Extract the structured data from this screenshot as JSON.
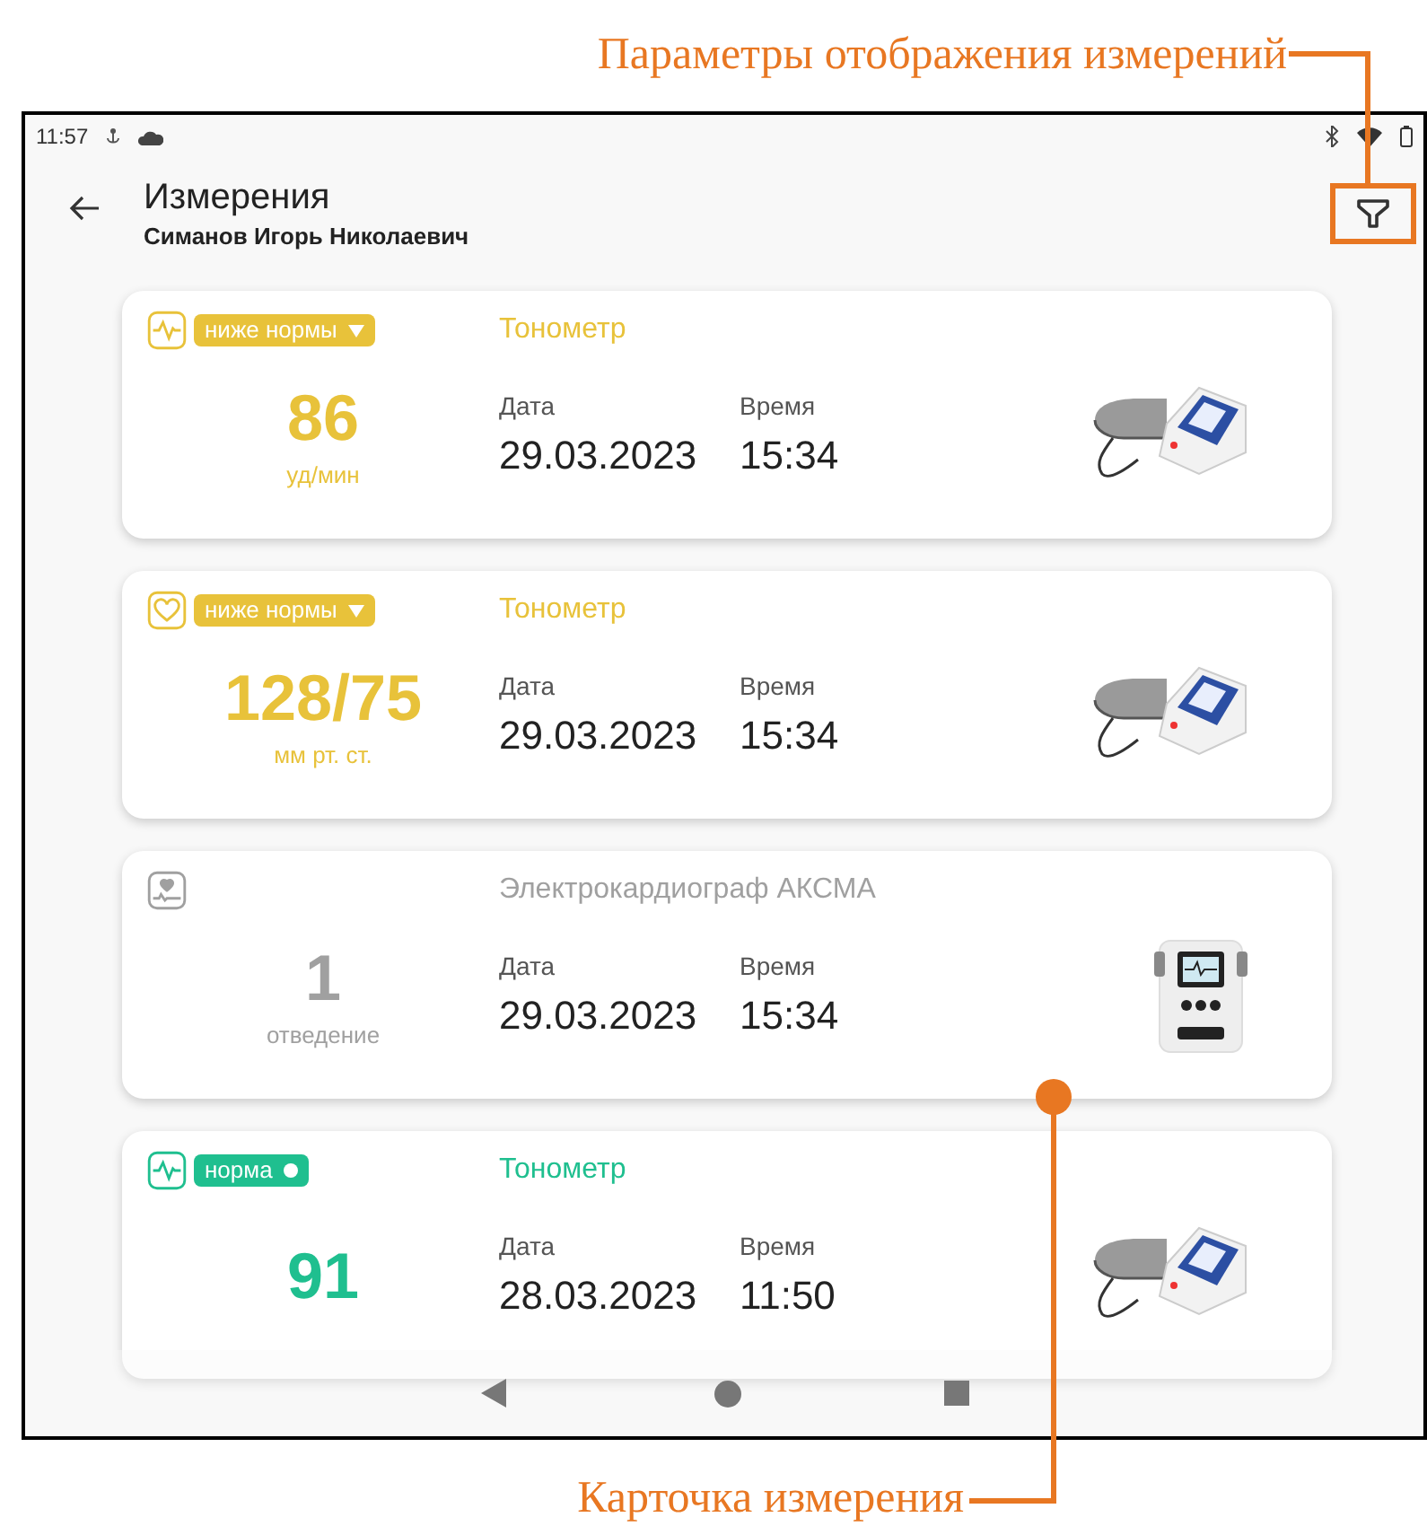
{
  "annotations": {
    "filter": "Параметры отображения измерений",
    "card": "Карточка измерения"
  },
  "status_bar": {
    "time": "11:57"
  },
  "header": {
    "title": "Измерения",
    "subtitle": "Симанов Игорь Николаевич"
  },
  "cards": [
    {
      "kind": "pulse",
      "color": "#e8c23a",
      "badge": {
        "kind": "below",
        "label": "ниже нормы"
      },
      "device": "Тонометр",
      "value": "86",
      "unit": "уд/мин",
      "date_label": "Дата",
      "date": "29.03.2023",
      "time_label": "Время",
      "time": "15:34",
      "picture": {
        "kind": "tonometer"
      }
    },
    {
      "kind": "pressure",
      "color": "#e8c23a",
      "badge": {
        "kind": "below",
        "label": "ниже нормы"
      },
      "device": "Тонометр",
      "value": "128/75",
      "unit": "мм рт. ст.",
      "date_label": "Дата",
      "date": "29.03.2023",
      "time_label": "Время",
      "time": "15:34",
      "picture": {
        "kind": "tonometer"
      }
    },
    {
      "kind": "ecg",
      "color": "#a0a0a0",
      "device": "Электрокардиограф АКСМА",
      "value": "1",
      "unit": "отведение",
      "date_label": "Дата",
      "date": "29.03.2023",
      "time_label": "Время",
      "time": "15:34",
      "picture": {
        "kind": "ecg"
      }
    },
    {
      "kind": "pulse",
      "color": "#1fbf8f",
      "badge": {
        "kind": "normal",
        "label": "норма"
      },
      "device": "Тонометр",
      "value": "91",
      "date_label": "Дата",
      "date": "28.03.2023",
      "time_label": "Время",
      "time": "11:50",
      "picture": {
        "kind": "tonometer"
      }
    }
  ]
}
